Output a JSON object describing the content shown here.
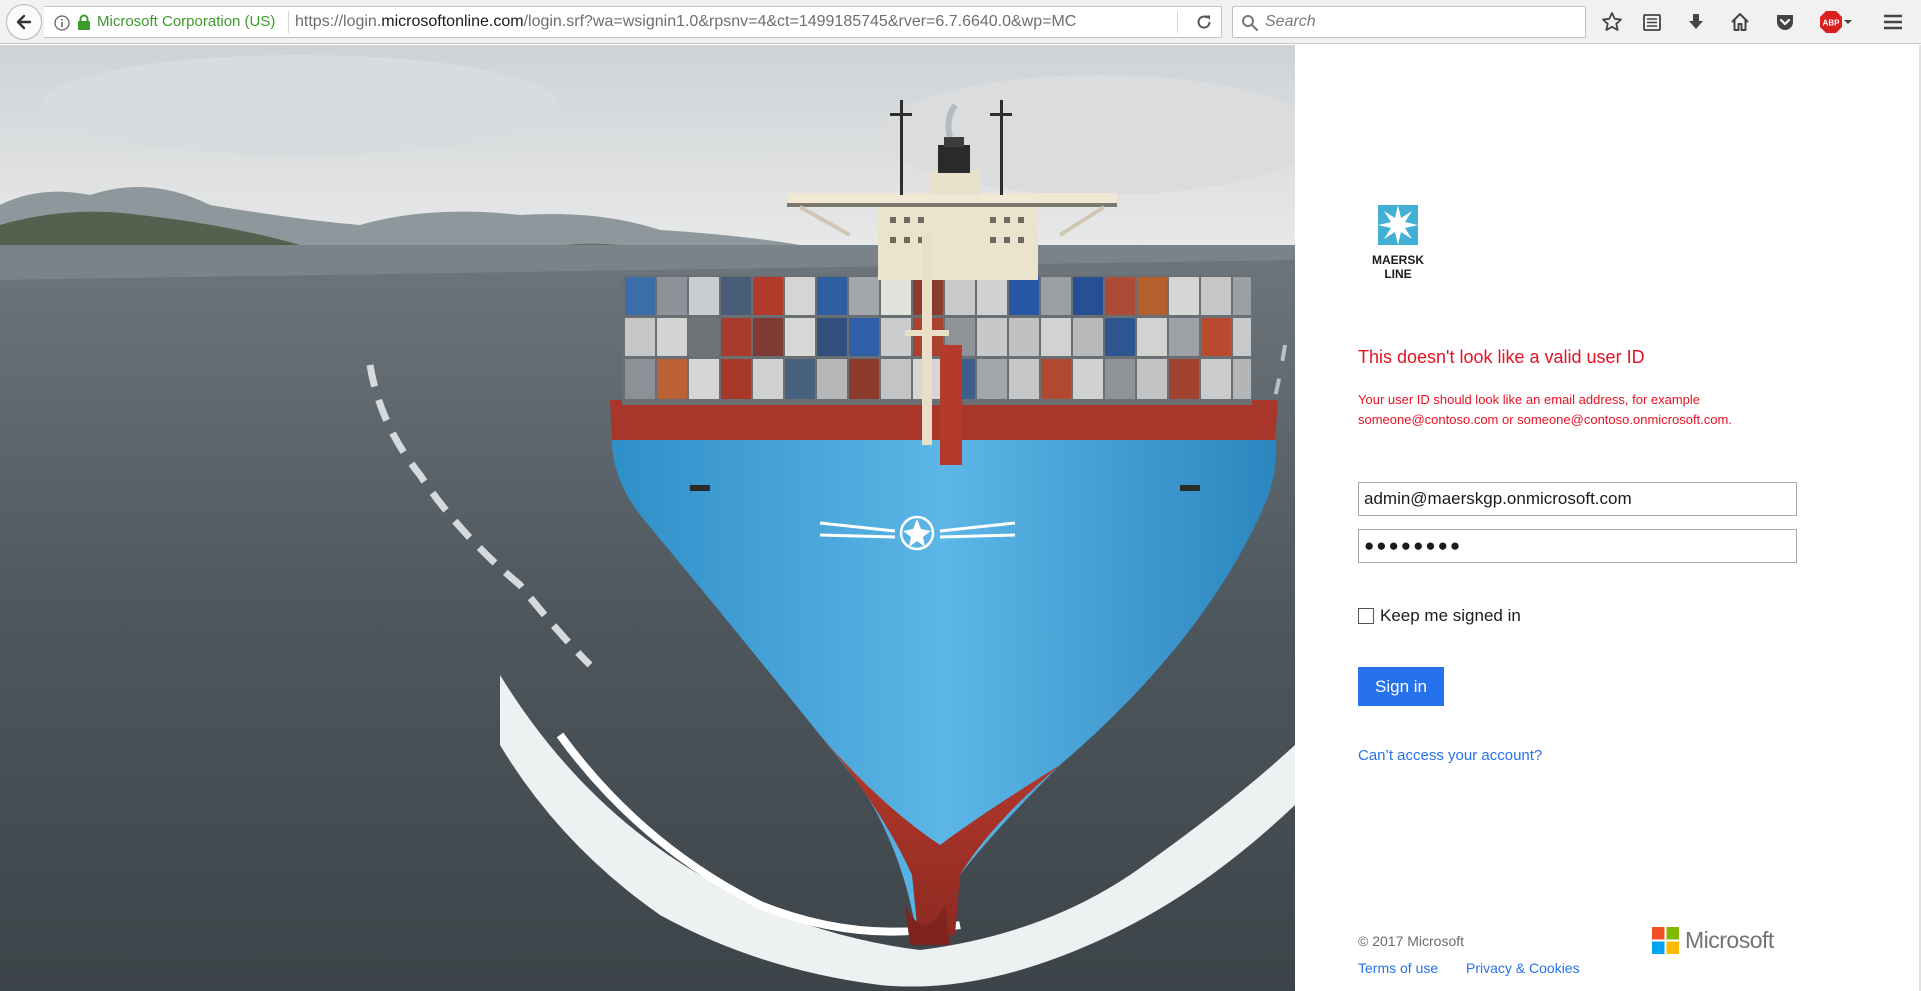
{
  "browser": {
    "identity_label": "Microsoft Corporation (US)",
    "url_prefix": "https://login.",
    "url_host": "microsoftonline.com",
    "url_suffix": "/login.srf?wa=wsignin1.0&rpsnv=4&ct=1499185745&rver=6.7.6640.0&wp=MC",
    "search_placeholder": "Search",
    "adblock_badge": "ABP"
  },
  "brand": {
    "logo_line1": "MAERSK",
    "logo_line2": "LINE"
  },
  "signin": {
    "error_title": "This doesn't look like a valid user ID",
    "error_body_line1": "Your user ID should look like an email address, for example",
    "error_body_line2": "someone@contoso.com or someone@contoso.onmicrosoft.com.",
    "username_value": "admin@maerskgp.onmicrosoft.com",
    "password_value": "●●●●●●●●",
    "keep_signed_in_label": "Keep me signed in",
    "keep_signed_in_checked": false,
    "signin_button_label": "Sign in",
    "cant_access_link": "Can’t access your account?"
  },
  "footer": {
    "copyright": "© 2017 Microsoft",
    "terms_link": "Terms of use",
    "privacy_link": "Privacy & Cookies",
    "ms_logo_text": "Microsoft"
  },
  "colors": {
    "error": "#e81123",
    "accent": "#2672ec",
    "secure_green": "#3c9a2a",
    "maersk_blue": "#42b0d5",
    "hull_blue": "#3aa0d8",
    "hull_red": "#b8352a"
  }
}
